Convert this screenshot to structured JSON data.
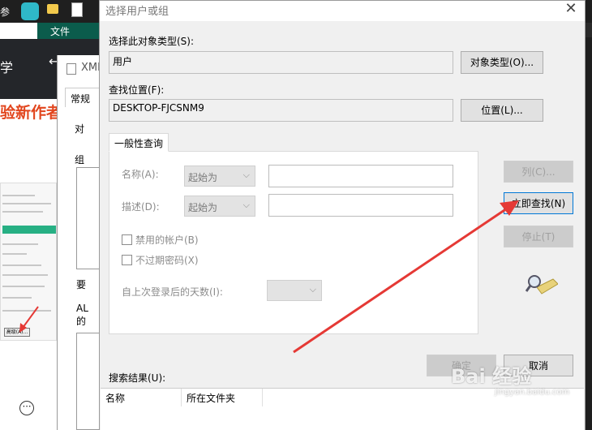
{
  "background": {
    "taskbar_text": "参",
    "ribbon_file": "文件",
    "dark_text": "学",
    "nav_back": "←",
    "orange_title": "验新作者",
    "props_title": "XMl",
    "props_tab": "常规",
    "props_text1": "对",
    "props_text2": "组",
    "props_text3": "要",
    "props_text4": "AL\n的",
    "mini_button": "高级(A)...",
    "more_glyph": "⋯"
  },
  "dialog": {
    "title": "选择用户或组",
    "close": "✕",
    "object_type_label": "选择此对象类型(S):",
    "object_type_value": "用户",
    "object_type_button": "对象类型(O)...",
    "location_label": "查找位置(F):",
    "location_value": "DESKTOP-FJCSNM9",
    "location_button": "位置(L)...",
    "tab_general": "一般性查询",
    "name_label": "名称(A):",
    "name_combo": "起始为",
    "desc_label": "描述(D):",
    "desc_combo": "起始为",
    "disabled_accounts": "禁用的帐户(B)",
    "non_expiring": "不过期密码(X)",
    "days_since_login": "自上次登录后的天数(I):",
    "columns_button": "列(C)...",
    "find_now_button": "立即查找(N)",
    "stop_button": "停止(T)",
    "ok_button": "确定",
    "cancel_button": "取消",
    "results_label": "搜索结果(U):",
    "results_columns": [
      "名称",
      "所在文件夹"
    ]
  },
  "watermark": {
    "text": "Bai 经验",
    "sub": "jingyan.baidu.com"
  },
  "colors": {
    "annotation_arrow": "#e53935",
    "ribbon": "#0b5c4c",
    "accent_focus": "#0078d7"
  }
}
